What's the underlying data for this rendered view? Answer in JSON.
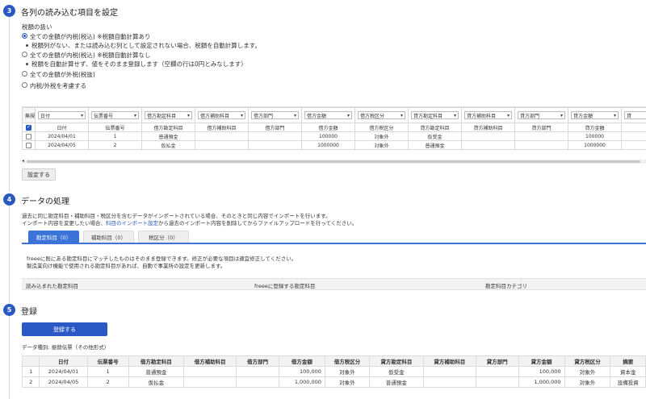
{
  "section3": {
    "step": "3",
    "title": "各列の読み込む項目を設定",
    "tax_heading": "税額の扱い",
    "options": [
      {
        "label": "全ての金額が内税(税込) ※税額自動計算あり",
        "selected": true,
        "note": "税額列がない、または読み込む列として設定されない場合、税額を自動計算します。"
      },
      {
        "label": "全ての金額が内税(税込) ※税額自動計算なし",
        "selected": false,
        "note": "税額を自動計算せず、値をそのまま登録します（空欄の行は0円とみなします）"
      },
      {
        "label": "全ての金額が外税(税抜)",
        "selected": false,
        "note": ""
      },
      {
        "label": "内税/外税を考慮する",
        "selected": false,
        "note": ""
      }
    ],
    "mapping": {
      "ignore_label": "無視",
      "selects": [
        "日付",
        "伝票番号",
        "借方勘定科目",
        "借方補助科目",
        "借方部門",
        "借方金額",
        "借方税区分",
        "貸方勘定科目",
        "貸方補助科目",
        "貸方部門",
        "貸方金額",
        "貸"
      ],
      "header_row": [
        "日付",
        "伝票番号",
        "借方勘定科目",
        "借方補助科目",
        "借方部門",
        "借方金額",
        "借方税区分",
        "貸方勘定科目",
        "貸方補助科目",
        "貸方部門",
        "貸方金額",
        "貸"
      ],
      "rows": [
        [
          "2024/04/01",
          "1",
          "普通預金",
          "",
          "",
          "100000",
          "対象外",
          "仮受金",
          "",
          "",
          "100000",
          ""
        ],
        [
          "2024/04/05",
          "2",
          "仮払金",
          "",
          "",
          "1000000",
          "対象外",
          "普通預金",
          "",
          "",
          "1000000",
          ""
        ]
      ],
      "scroll_left": "◂"
    },
    "set_button": "設定する"
  },
  "section4": {
    "step": "4",
    "title": "データの処理",
    "desc_line1": "過去に同じ勘定科目・補助科目・税区分を含むデータがインポートされている場合、そのときと同じ内容でインポートを行います。",
    "desc_line2_pre": "インポート内容を変更したい場合、",
    "desc_line2_link": "科目のインポート設定",
    "desc_line2_post": "から過去のインポート内容を削除してからファイルアップロードを行ってください。",
    "tabs": [
      "勘定科目（0）",
      "補助科目（0）",
      "税区分（0）"
    ],
    "info_line1": "freeeに既にある勘定科目にマッチしたものはそのまま登録できます。修正が必要な項目は適宜修正してください。",
    "info_line2": "製造業向け機能で使用される勘定科目があれば、自動で事業所の設定を更新します。",
    "table_headers": [
      "読み込まれた勘定科目",
      "freeeに登録する勘定科目",
      "勘定科目カテゴリ"
    ]
  },
  "section5": {
    "step": "5",
    "title": "登録",
    "register_button": "登録する",
    "data_type_label": "データ種別: 振替伝票（その他形式）",
    "headers": [
      "",
      "日付",
      "伝票番号",
      "借方勘定科目",
      "借方補助科目",
      "借方部門",
      "借方金額",
      "借方税区分",
      "貸方勘定科目",
      "貸方補助科目",
      "貸方部門",
      "貸方金額",
      "貸方税区分",
      "摘要"
    ],
    "rows": [
      [
        "1",
        "2024/04/01",
        "1",
        "普通預金",
        "",
        "",
        "100,000",
        "対象外",
        "仮受金",
        "",
        "",
        "100,000",
        "対象外",
        "資本金"
      ],
      [
        "2",
        "2024/04/05",
        "2",
        "仮払金",
        "",
        "",
        "1,000,000",
        "対象外",
        "普通預金",
        "",
        "",
        "1,000,000",
        "対象外",
        "設備投資"
      ]
    ]
  },
  "colors": {
    "accent": "#2b59c3",
    "tab_active": "#3b73d9",
    "link": "#2b59c3"
  }
}
